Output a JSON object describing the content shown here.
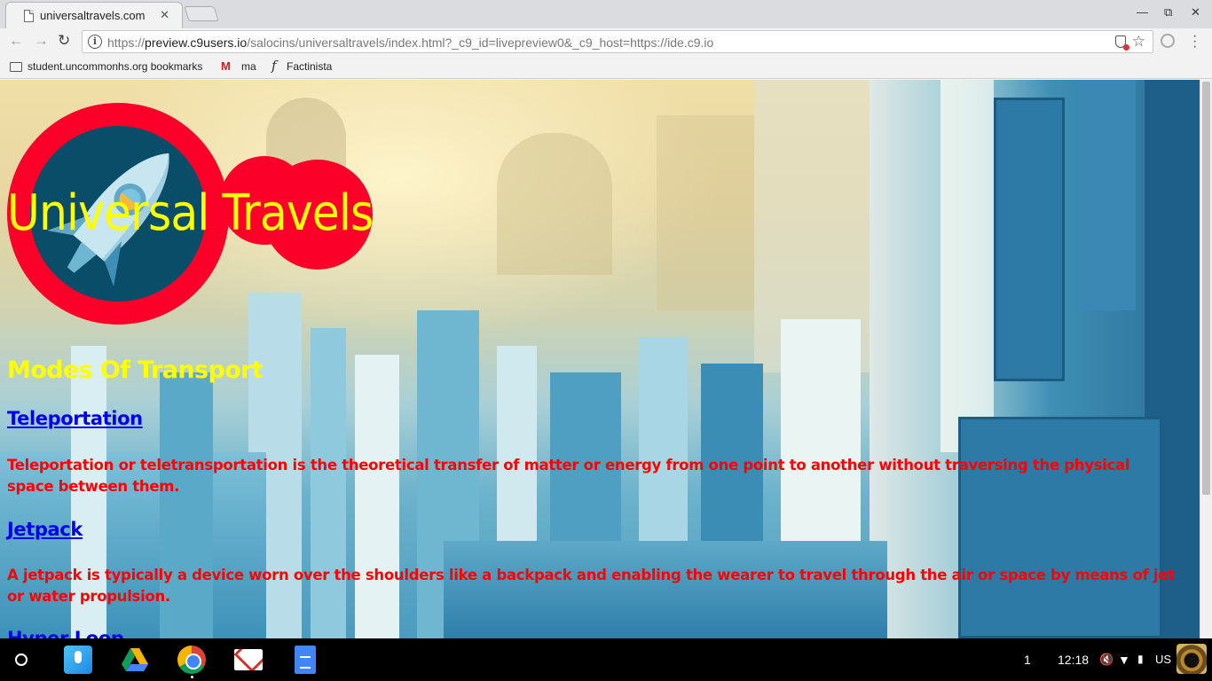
{
  "browser": {
    "tab_title": "universaltravels.com",
    "tab_close": "✕",
    "window_controls": {
      "minimize": "—",
      "restore": "⧉",
      "close": "✕"
    },
    "url_prefix": "https://",
    "url_host": "preview.c9users.io",
    "url_path": "/salocins/universaltravels/index.html?_c9_id=livepreview0&_c9_host=https://ide.c9.io",
    "nav": {
      "back": "←",
      "forward": "→",
      "reload": "↻"
    },
    "bookmarks": [
      {
        "label": "student.uncommonhs.org bookmarks",
        "icon": "folder-icon"
      },
      {
        "label": "ma",
        "icon": "gmail-icon",
        "glyph": "M"
      },
      {
        "label": "Factinista",
        "icon": "factinista-icon",
        "glyph": "f"
      }
    ]
  },
  "page": {
    "logo_text": "Universal Travels",
    "section_title": "Modes Of Transport",
    "modes": [
      {
        "name": "Teleportation",
        "description": "Teleportation or teletransportation is the theoretical transfer of matter or energy from one point to another without traversing the physical space between them."
      },
      {
        "name": "Jetpack",
        "description": "A jetpack is typically a device worn over the shoulders like a backpack and enabling the wearer to travel through the air or space by means of jet or water propulsion."
      },
      {
        "name": "Hyper Loop",
        "description": ""
      }
    ]
  },
  "shelf": {
    "notifications": "1",
    "time": "12:18",
    "keyboard": "US"
  }
}
